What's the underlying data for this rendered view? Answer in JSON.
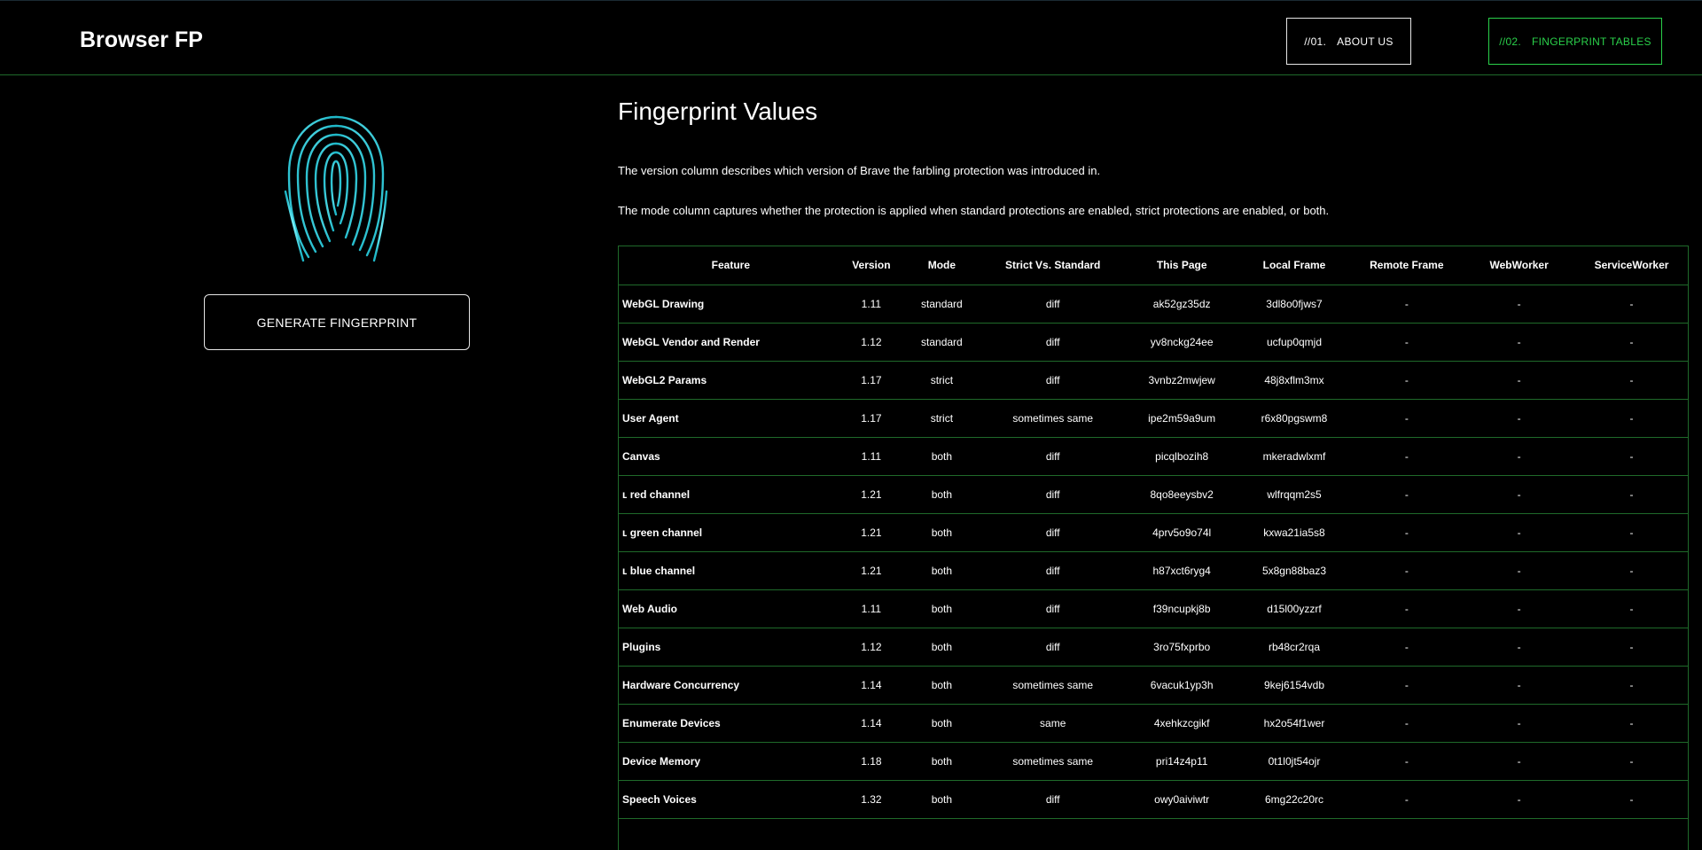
{
  "header": {
    "brand": "Browser FP",
    "nav": [
      {
        "num": "//01.",
        "label": "ABOUT US"
      },
      {
        "num": "//02.",
        "label": "FINGERPRINT TABLES"
      }
    ],
    "accent_color": "#2ad04a"
  },
  "sidebar": {
    "image": "fingerprint-icon",
    "generate_label": "GENERATE FINGERPRINT"
  },
  "main": {
    "title": "Fingerprint Values",
    "desc1": "The version column describes which version of Brave the farbling protection was introduced in.",
    "desc2": "The mode column captures whether the protection is applied when standard protections are enabled, strict protections are enabled, or both."
  },
  "table": {
    "headers": [
      "Feature",
      "Version",
      "Mode",
      "Strict Vs. Standard",
      "This Page",
      "Local Frame",
      "Remote Frame",
      "WebWorker",
      "ServiceWorker"
    ],
    "rows": [
      [
        "WebGL Drawing",
        "1.11",
        "standard",
        "diff",
        "ak52gz35dz",
        "3dl8o0fjws7",
        "-",
        "-",
        "-"
      ],
      [
        "WebGL Vendor and Render",
        "1.12",
        "standard",
        "diff",
        "yv8nckg24ee",
        "ucfup0qmjd",
        "-",
        "-",
        "-"
      ],
      [
        "WebGL2 Params",
        "1.17",
        "strict",
        "diff",
        "3vnbz2mwjew",
        "48j8xflm3mx",
        "-",
        "-",
        "-"
      ],
      [
        "User Agent",
        "1.17",
        "strict",
        "sometimes same",
        "ipe2m59a9um",
        "r6x80pgswm8",
        "-",
        "-",
        "-"
      ],
      [
        "Canvas",
        "1.11",
        "both",
        "diff",
        "picqlbozih8",
        "mkeradwlxmf",
        "-",
        "-",
        "-"
      ],
      [
        "ʟ red channel",
        "1.21",
        "both",
        "diff",
        "8qo8eeysbv2",
        "wlfrqqm2s5",
        "-",
        "-",
        "-"
      ],
      [
        "ʟ green channel",
        "1.21",
        "both",
        "diff",
        "4prv5o9o74l",
        "kxwa21ia5s8",
        "-",
        "-",
        "-"
      ],
      [
        "ʟ blue channel",
        "1.21",
        "both",
        "diff",
        "h87xct6ryg4",
        "5x8gn88baz3",
        "-",
        "-",
        "-"
      ],
      [
        "Web Audio",
        "1.11",
        "both",
        "diff",
        "f39ncupkj8b",
        "d15l00yzzrf",
        "-",
        "-",
        "-"
      ],
      [
        "Plugins",
        "1.12",
        "both",
        "diff",
        "3ro75fxprbo",
        "rb48cr2rqa",
        "-",
        "-",
        "-"
      ],
      [
        "Hardware Concurrency",
        "1.14",
        "both",
        "sometimes same",
        "6vacuk1yp3h",
        "9kej6154vdb",
        "-",
        "-",
        "-"
      ],
      [
        "Enumerate Devices",
        "1.14",
        "both",
        "same",
        "4xehkzcgikf",
        "hx2o54f1wer",
        "-",
        "-",
        "-"
      ],
      [
        "Device Memory",
        "1.18",
        "both",
        "sometimes same",
        "pri14z4p11",
        "0t1l0jt54ojr",
        "-",
        "-",
        "-"
      ],
      [
        "Speech Voices",
        "1.32",
        "both",
        "diff",
        "owy0aiviwtr",
        "6mg22c20rc",
        "-",
        "-",
        "-"
      ]
    ]
  }
}
